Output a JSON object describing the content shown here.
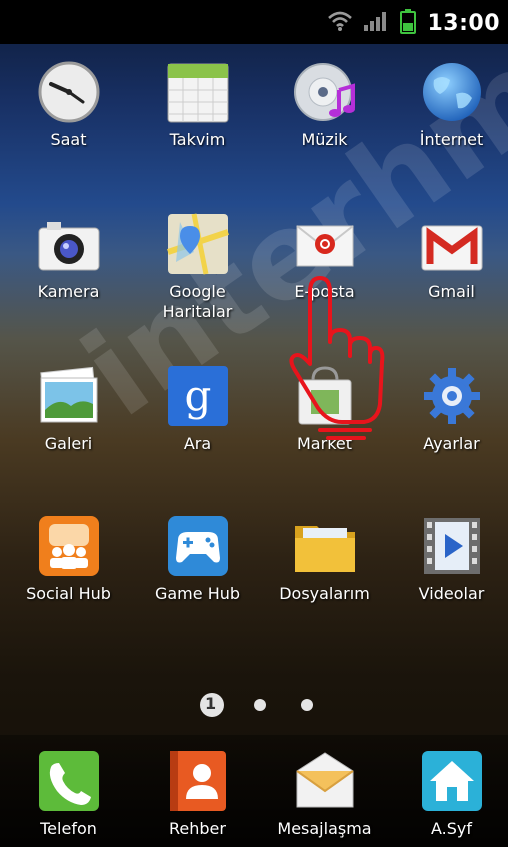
{
  "status": {
    "time": "13:00",
    "icons": [
      "wifi-icon",
      "signal-icon",
      "battery-icon"
    ]
  },
  "apps": [
    {
      "label": "Saat",
      "icon": "clock-icon"
    },
    {
      "label": "Takvim",
      "icon": "calendar-icon"
    },
    {
      "label": "Müzik",
      "icon": "music-icon"
    },
    {
      "label": "İnternet",
      "icon": "globe-icon"
    },
    {
      "label": "Kamera",
      "icon": "camera-icon"
    },
    {
      "label": "Google\nHaritalar",
      "icon": "maps-icon"
    },
    {
      "label": "E-posta",
      "icon": "email-icon"
    },
    {
      "label": "Gmail",
      "icon": "gmail-icon"
    },
    {
      "label": "Galeri",
      "icon": "gallery-icon"
    },
    {
      "label": "Ara",
      "icon": "google-search-icon"
    },
    {
      "label": "Market",
      "icon": "market-icon"
    },
    {
      "label": "Ayarlar",
      "icon": "settings-gear-icon"
    },
    {
      "label": "Social Hub",
      "icon": "social-hub-icon"
    },
    {
      "label": "Game Hub",
      "icon": "gamepad-icon"
    },
    {
      "label": "Dosyalarım",
      "icon": "folder-icon"
    },
    {
      "label": "Videolar",
      "icon": "video-icon"
    }
  ],
  "page_indicator": {
    "current": "1",
    "total_pages": 3
  },
  "dock": [
    {
      "label": "Telefon",
      "icon": "phone-icon"
    },
    {
      "label": "Rehber",
      "icon": "contacts-icon"
    },
    {
      "label": "Mesajlaşma",
      "icon": "message-icon"
    },
    {
      "label": "A.Syf",
      "icon": "home-icon"
    }
  ],
  "watermark_text": "interhm",
  "colors": {
    "status_bar": "#000000",
    "text": "#ffffff",
    "hand_outline": "#e8141c"
  }
}
